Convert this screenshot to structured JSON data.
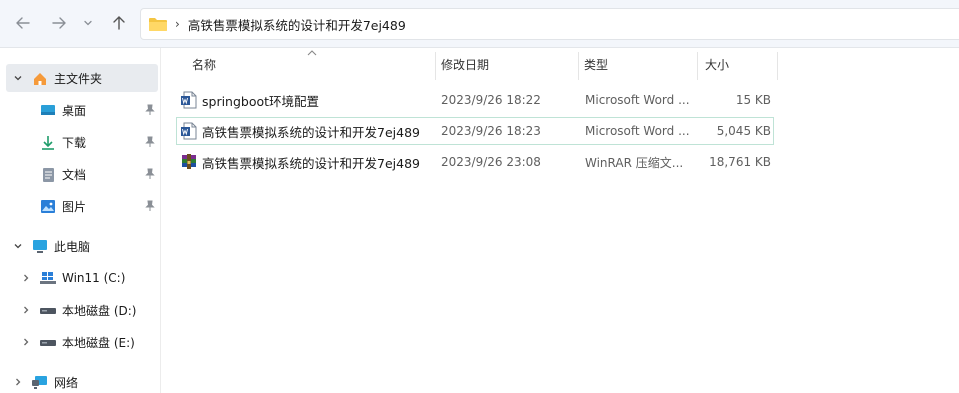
{
  "address": {
    "crumb": "高铁售票模拟系统的设计和开发7ej489"
  },
  "sidebar": {
    "items": [
      {
        "label": "主文件夹"
      },
      {
        "label": "桌面"
      },
      {
        "label": "下载"
      },
      {
        "label": "文档"
      },
      {
        "label": "图片"
      },
      {
        "label": "此电脑"
      },
      {
        "label": "Win11 (C:)"
      },
      {
        "label": "本地磁盘 (D:)"
      },
      {
        "label": "本地磁盘 (E:)"
      },
      {
        "label": "网络"
      }
    ]
  },
  "columns": {
    "name": "名称",
    "modified": "修改日期",
    "type": "类型",
    "size": "大小"
  },
  "files": [
    {
      "name": "springboot环境配置",
      "modified": "2023/9/26 18:22",
      "type": "Microsoft Word ...",
      "size": "15 KB",
      "icon": "word-icon"
    },
    {
      "name": "高铁售票模拟系统的设计和开发7ej489",
      "modified": "2023/9/26 18:23",
      "type": "Microsoft Word ...",
      "size": "5,045 KB",
      "icon": "word-icon"
    },
    {
      "name": "高铁售票模拟系统的设计和开发7ej489",
      "modified": "2023/9/26 23:08",
      "type": "WinRAR 压缩文...",
      "size": "18,761 KB",
      "icon": "winrar-icon"
    }
  ],
  "colors": {
    "accent": "#0067c0",
    "folder": "#f4c542",
    "selected_row_border": "#bfe3d6"
  }
}
